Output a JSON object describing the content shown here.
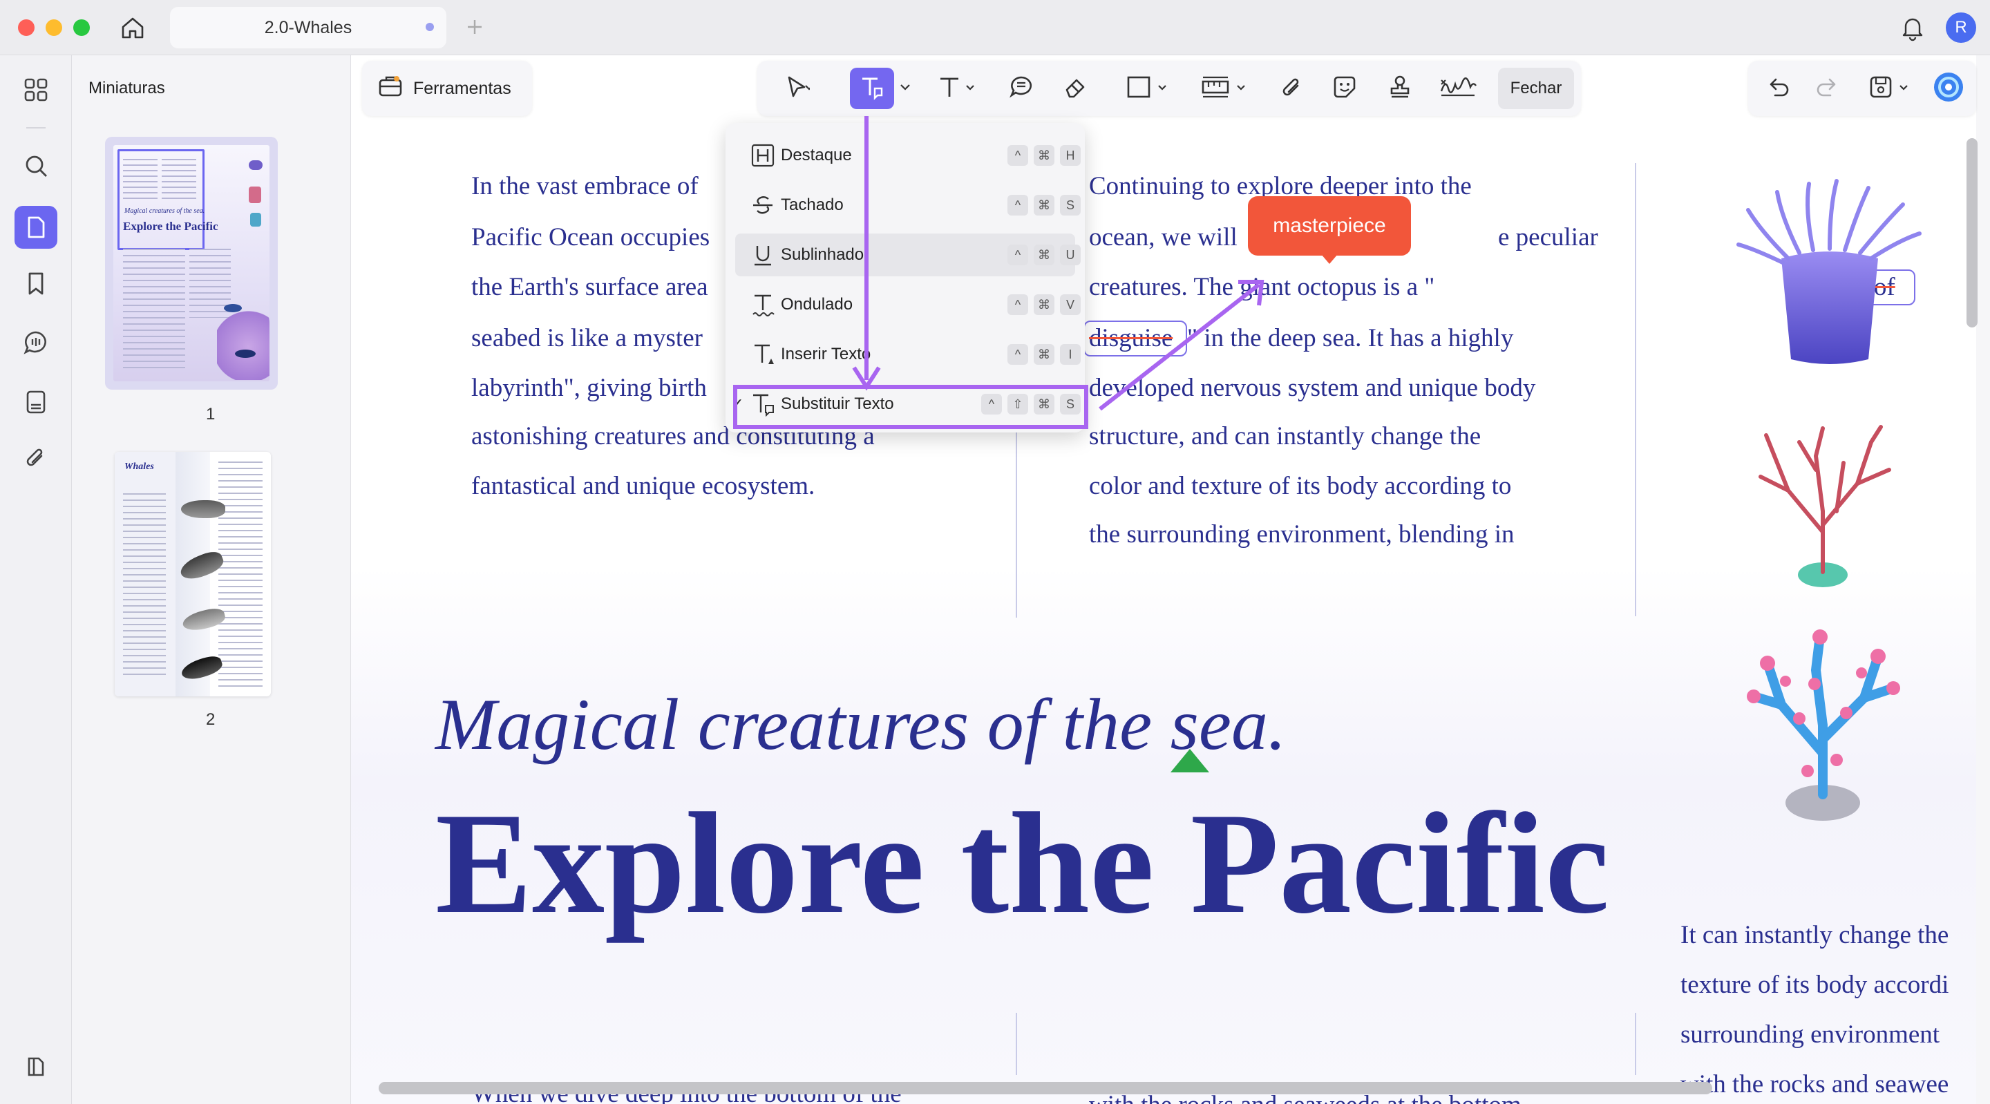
{
  "window": {
    "tab_title": "2.0-Whales",
    "avatar_initial": "R",
    "colors": {
      "accent": "#6b66f0",
      "purple_annotation": "#a865f0",
      "tooltip": "#f2563a",
      "text_blue": "#2a2f8f"
    }
  },
  "sidebar": {
    "title": "Miniaturas",
    "pages": [
      "1",
      "2"
    ],
    "thumb1": {
      "subtitle": "Magical creatures of the sea.",
      "title": "Explore the Pacific"
    },
    "thumb2": {
      "title": "Whales"
    }
  },
  "toolbar": {
    "tools_label": "Ferramentas",
    "close_label": "Fechar",
    "icons": [
      "cursor-icon",
      "text-markup-icon",
      "text-icon",
      "comment-icon",
      "eraser-icon",
      "rectangle-icon",
      "measure-icon",
      "attachment-icon",
      "sticker-icon",
      "stamp-icon",
      "signature-icon"
    ]
  },
  "menu": {
    "items": [
      {
        "label": "Destaque",
        "keys": [
          "^",
          "⌘",
          "H"
        ],
        "checked": ""
      },
      {
        "label": "Tachado",
        "keys": [
          "^",
          "⌘",
          "S"
        ],
        "checked": ""
      },
      {
        "label": "Sublinhado",
        "keys": [
          "^",
          "⌘",
          "U"
        ],
        "checked": ""
      },
      {
        "label": "Ondulado",
        "keys": [
          "^",
          "⌘",
          "V"
        ],
        "checked": ""
      },
      {
        "label": "Inserir Texto",
        "keys": [
          "^",
          "⌘",
          "I"
        ],
        "checked": ""
      },
      {
        "label": "Substituir Texto",
        "keys": [
          "^",
          "⇧",
          "⌘",
          "S"
        ],
        "checked": "✓"
      }
    ]
  },
  "tooltip": {
    "text": "masterpiece"
  },
  "doc": {
    "col1": [
      "In the vast embrace of",
      "Pacific Ocean occupies",
      "the Earth's surface area",
      "seabed is like a myster",
      "labyrinth\", giving birth",
      "astonishing creatures and constituting a",
      "fantastical and unique ecosystem."
    ],
    "col2": [
      "Continuing to explore deeper into the",
      "ocean, we will",
      "e peculiar",
      "creatures. The giant octopus is a \"",
      "master of",
      "disguise",
      "\" in the deep sea. It has a highly",
      "developed nervous system and unique body",
      "structure, and can instantly change the",
      "color and texture of its body according to",
      "the surrounding environment, blending in"
    ],
    "subtitle": "Magical creatures of the sea.",
    "title": "Explore the Pacific",
    "col3": [
      "It can instantly change the",
      "texture of its body accordi",
      "surrounding environment",
      "with the rocks and seawee"
    ],
    "bottom1": "When we dive deep into the bottom of the",
    "bottom2": "with the rocks and seaweeds at the bottom"
  }
}
